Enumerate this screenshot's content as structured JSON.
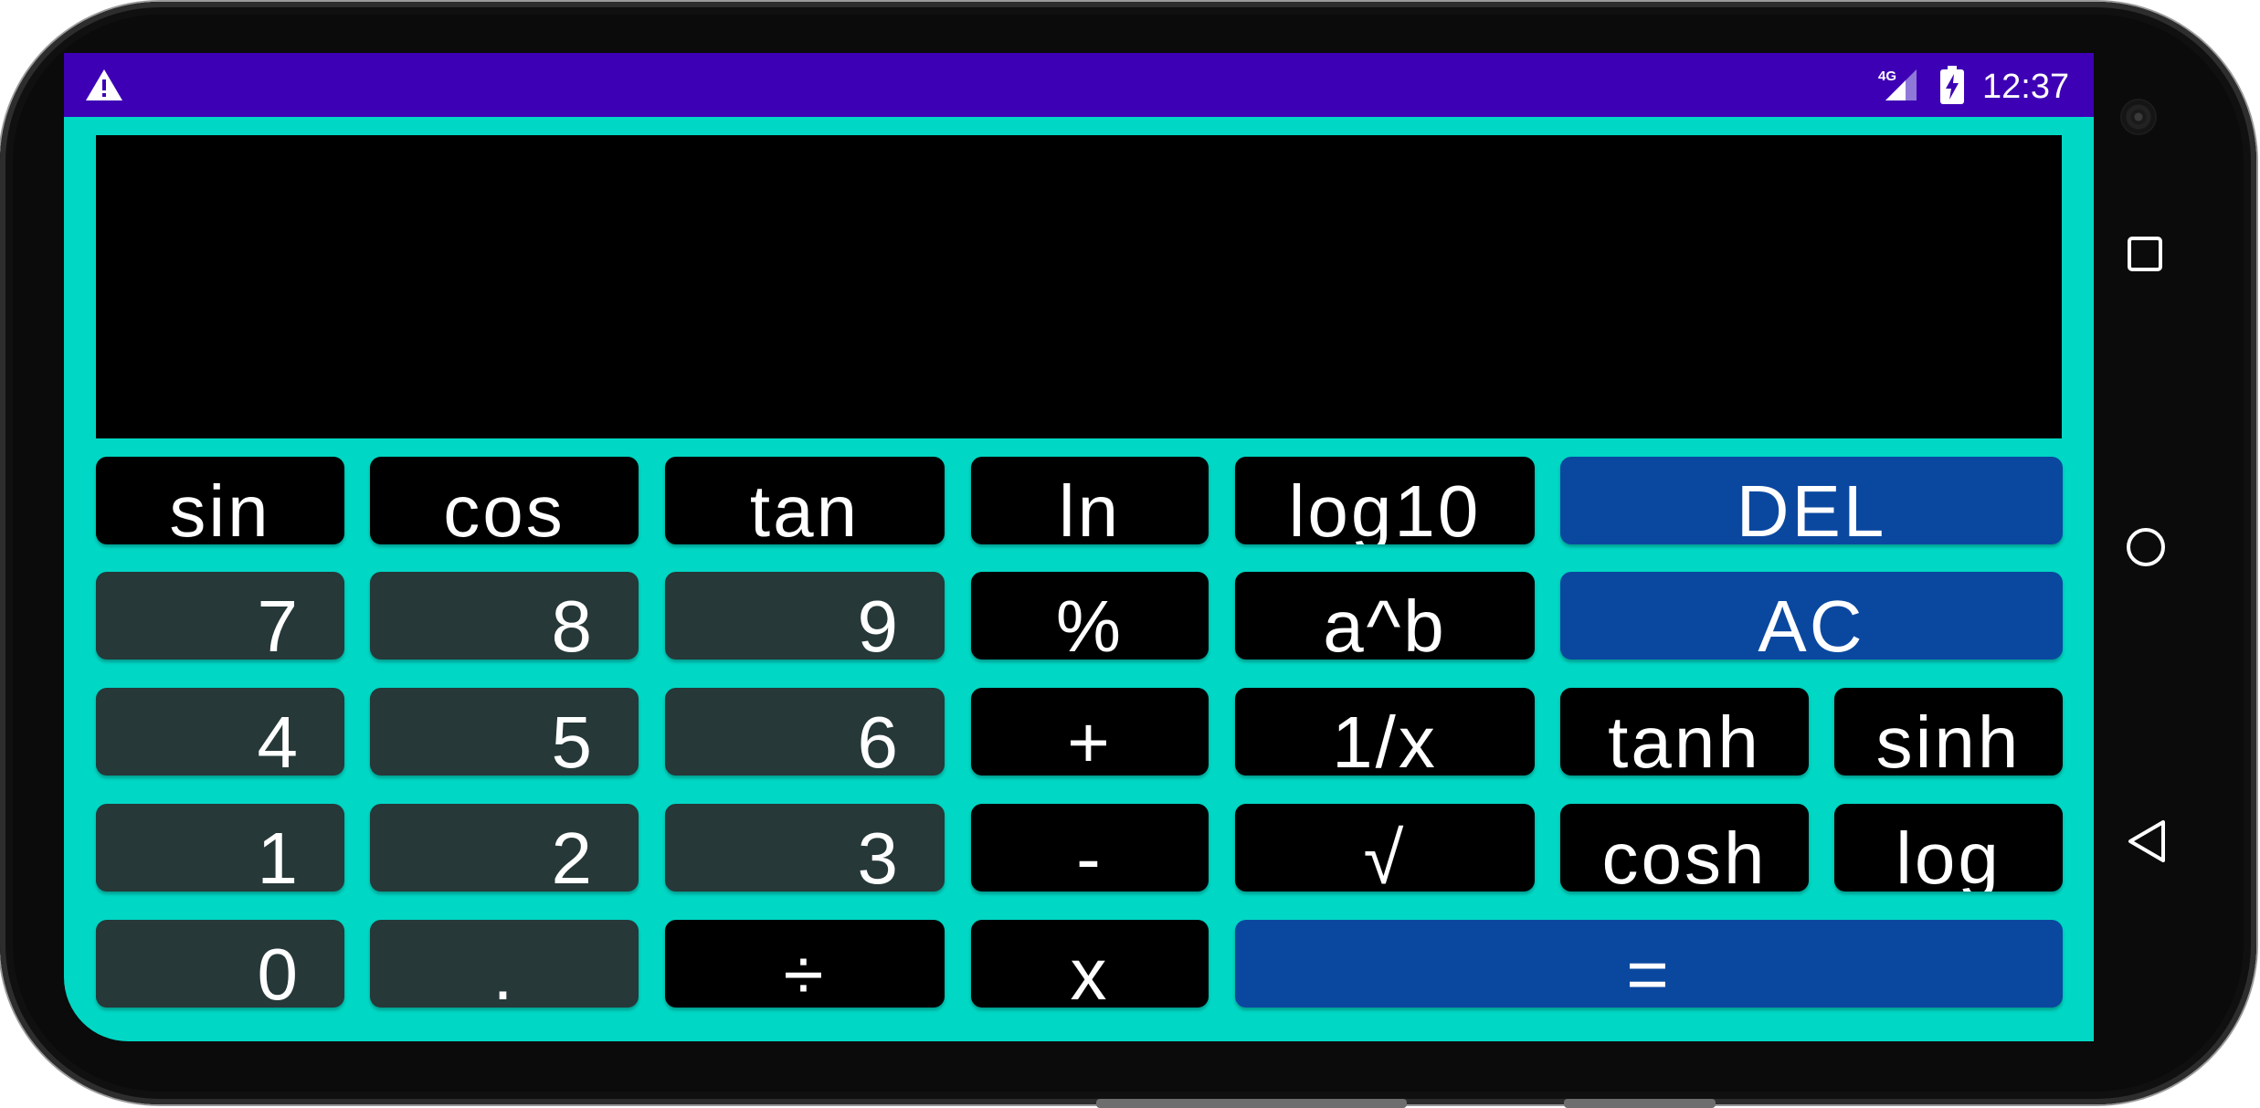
{
  "status_bar": {
    "network": "4G",
    "time": "12:37",
    "icons": [
      "warning-icon",
      "signal-icon",
      "battery-charging-icon"
    ]
  },
  "display": {
    "value": ""
  },
  "keys": {
    "sin": "sin",
    "cos": "cos",
    "tan": "tan",
    "ln": "ln",
    "log10": "log10",
    "del": "DEL",
    "seven": "7",
    "eight": "8",
    "nine": "9",
    "percent": "%",
    "power": "a^b",
    "ac": "AC",
    "four": "4",
    "five": "5",
    "six": "6",
    "plus": "+",
    "reciprocal": "1/x",
    "tanh": "tanh",
    "sinh": "sinh",
    "one": "1",
    "two": "2",
    "three": "3",
    "minus": "-",
    "sqrt": "√",
    "cosh": "cosh",
    "log": "log",
    "zero": "0",
    "dot": ".",
    "divide": "÷",
    "multiply": "x",
    "equals": "="
  },
  "colors": {
    "background": "#00d7c4",
    "status_bar": "#3e00b5",
    "function_key": "#000000",
    "number_key": "#263838",
    "accent_key": "#0a48a0"
  },
  "nav_bar": {
    "icons": [
      "recents-icon",
      "home-icon",
      "back-icon"
    ]
  }
}
